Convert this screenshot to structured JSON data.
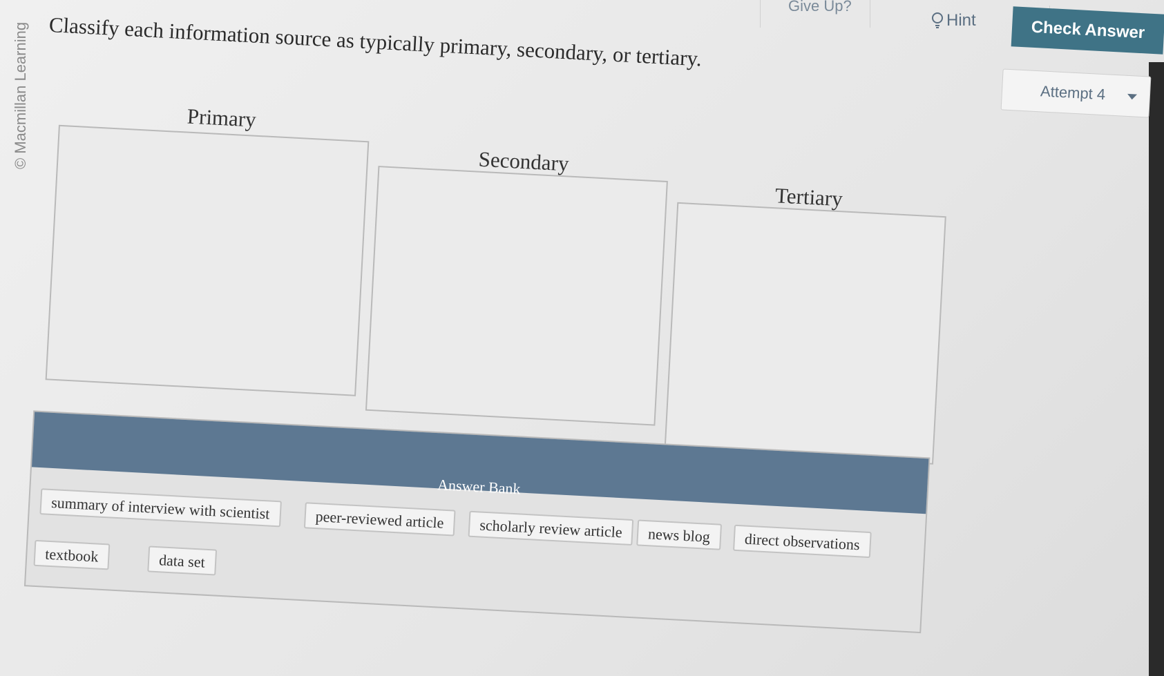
{
  "branding": {
    "copyright": "© Macmillan Learning"
  },
  "toolbar": {
    "give_up_label": "Give Up?",
    "hint_label": "Hint",
    "check_answer_label": "Check Answer",
    "attempt_label": "Attempt 4"
  },
  "question": {
    "prompt": "Classify each information source as typically primary, secondary, or tertiary."
  },
  "bins": [
    {
      "label": "Primary"
    },
    {
      "label": "Secondary"
    },
    {
      "label": "Tertiary"
    }
  ],
  "answer_bank": {
    "title": "Answer Bank",
    "items": [
      "summary of interview with scientist",
      "peer-reviewed article",
      "scholarly review article",
      "news blog",
      "direct observations",
      "textbook",
      "data set"
    ]
  },
  "colors": {
    "check_button": "#3f7386",
    "bank_header": "#5d7892",
    "toolbar_text": "#5b6f82"
  }
}
